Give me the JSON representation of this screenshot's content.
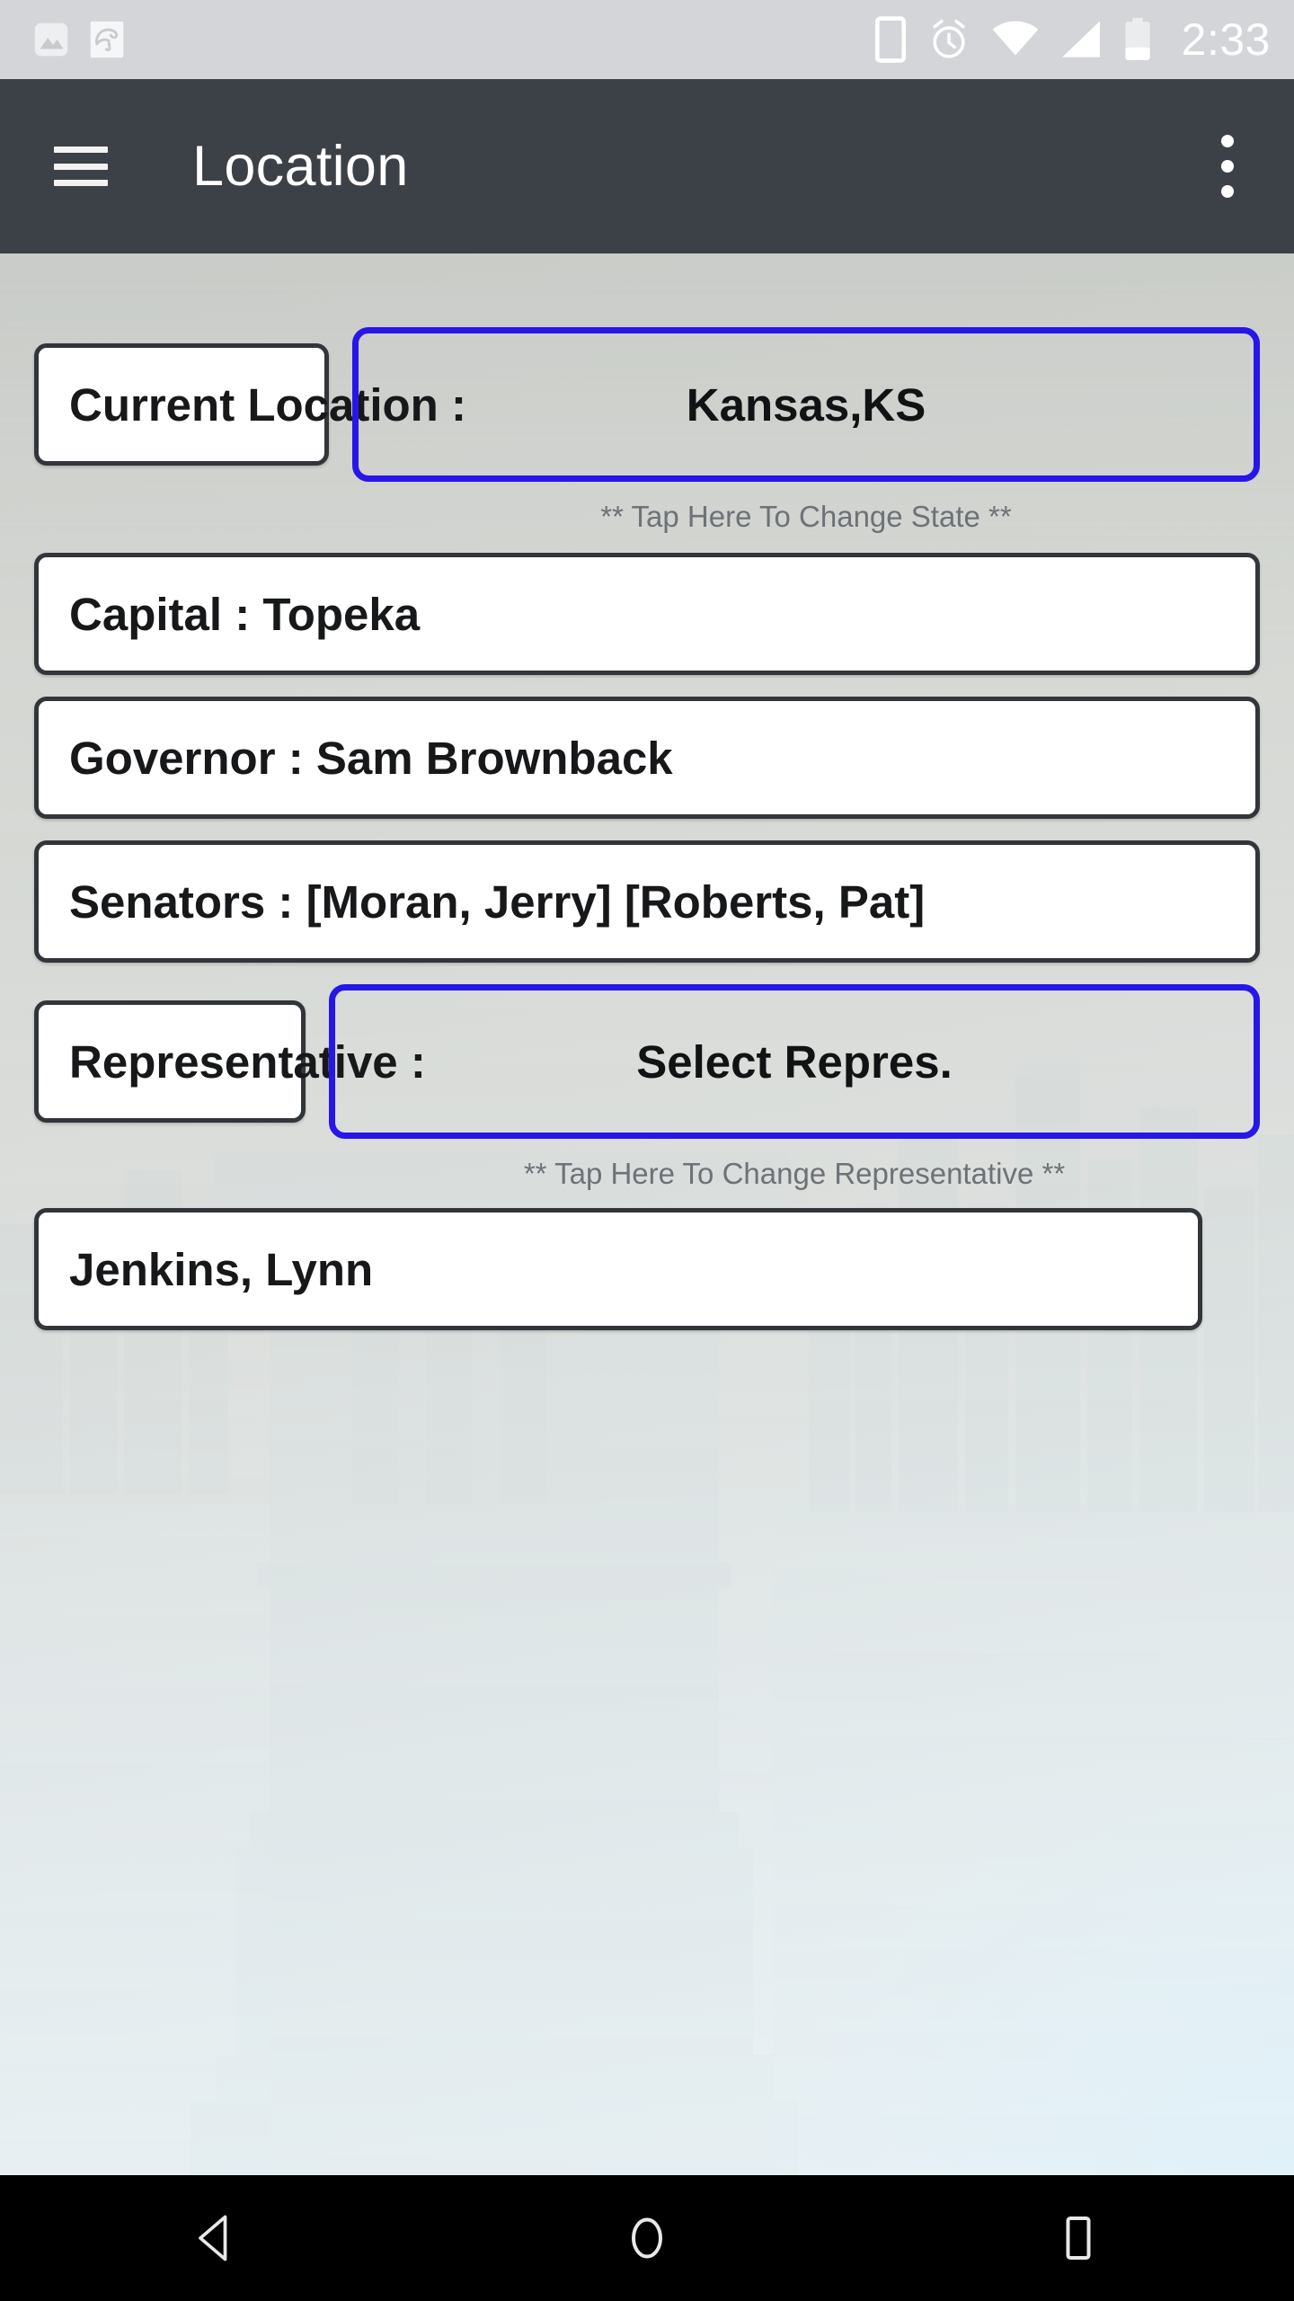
{
  "status_bar": {
    "time": "2:33",
    "left_icons": [
      "image-icon",
      "umbrella-icon"
    ],
    "right_icons": [
      "device-icon",
      "alarm-icon",
      "wifi-icon",
      "signal-icon",
      "battery-icon"
    ],
    "background_color": "#d3d5d8"
  },
  "app_bar": {
    "menu_icon": "hamburger-menu-icon",
    "title": "Location",
    "overflow_icon": "overflow-menu-icon",
    "background_color": "#3c4047",
    "text_color": "#ffffff"
  },
  "colors": {
    "accent_blue": "#2617e8",
    "box_border": "#32363b",
    "box_fill": "#ffffff",
    "hint_text": "#6e7278",
    "page_background": "#c9ccc8"
  },
  "form": {
    "current_location_label": "Current Location :",
    "state_button": "Kansas,KS",
    "state_hint": "** Tap Here To Change State **",
    "capital": "Capital : Topeka",
    "governor": "Governor : Sam Brownback",
    "senators": "Senators : [Moran, Jerry] [Roberts, Pat]",
    "representative_label": "Representative :",
    "representative_button": "Select Repres.",
    "representative_hint": "** Tap Here To Change Representative **",
    "representative_value": "Jenkins, Lynn"
  },
  "nav_bar": {
    "back": "back-icon",
    "home": "home-icon",
    "recents": "recents-icon",
    "background_color": "#000000"
  }
}
